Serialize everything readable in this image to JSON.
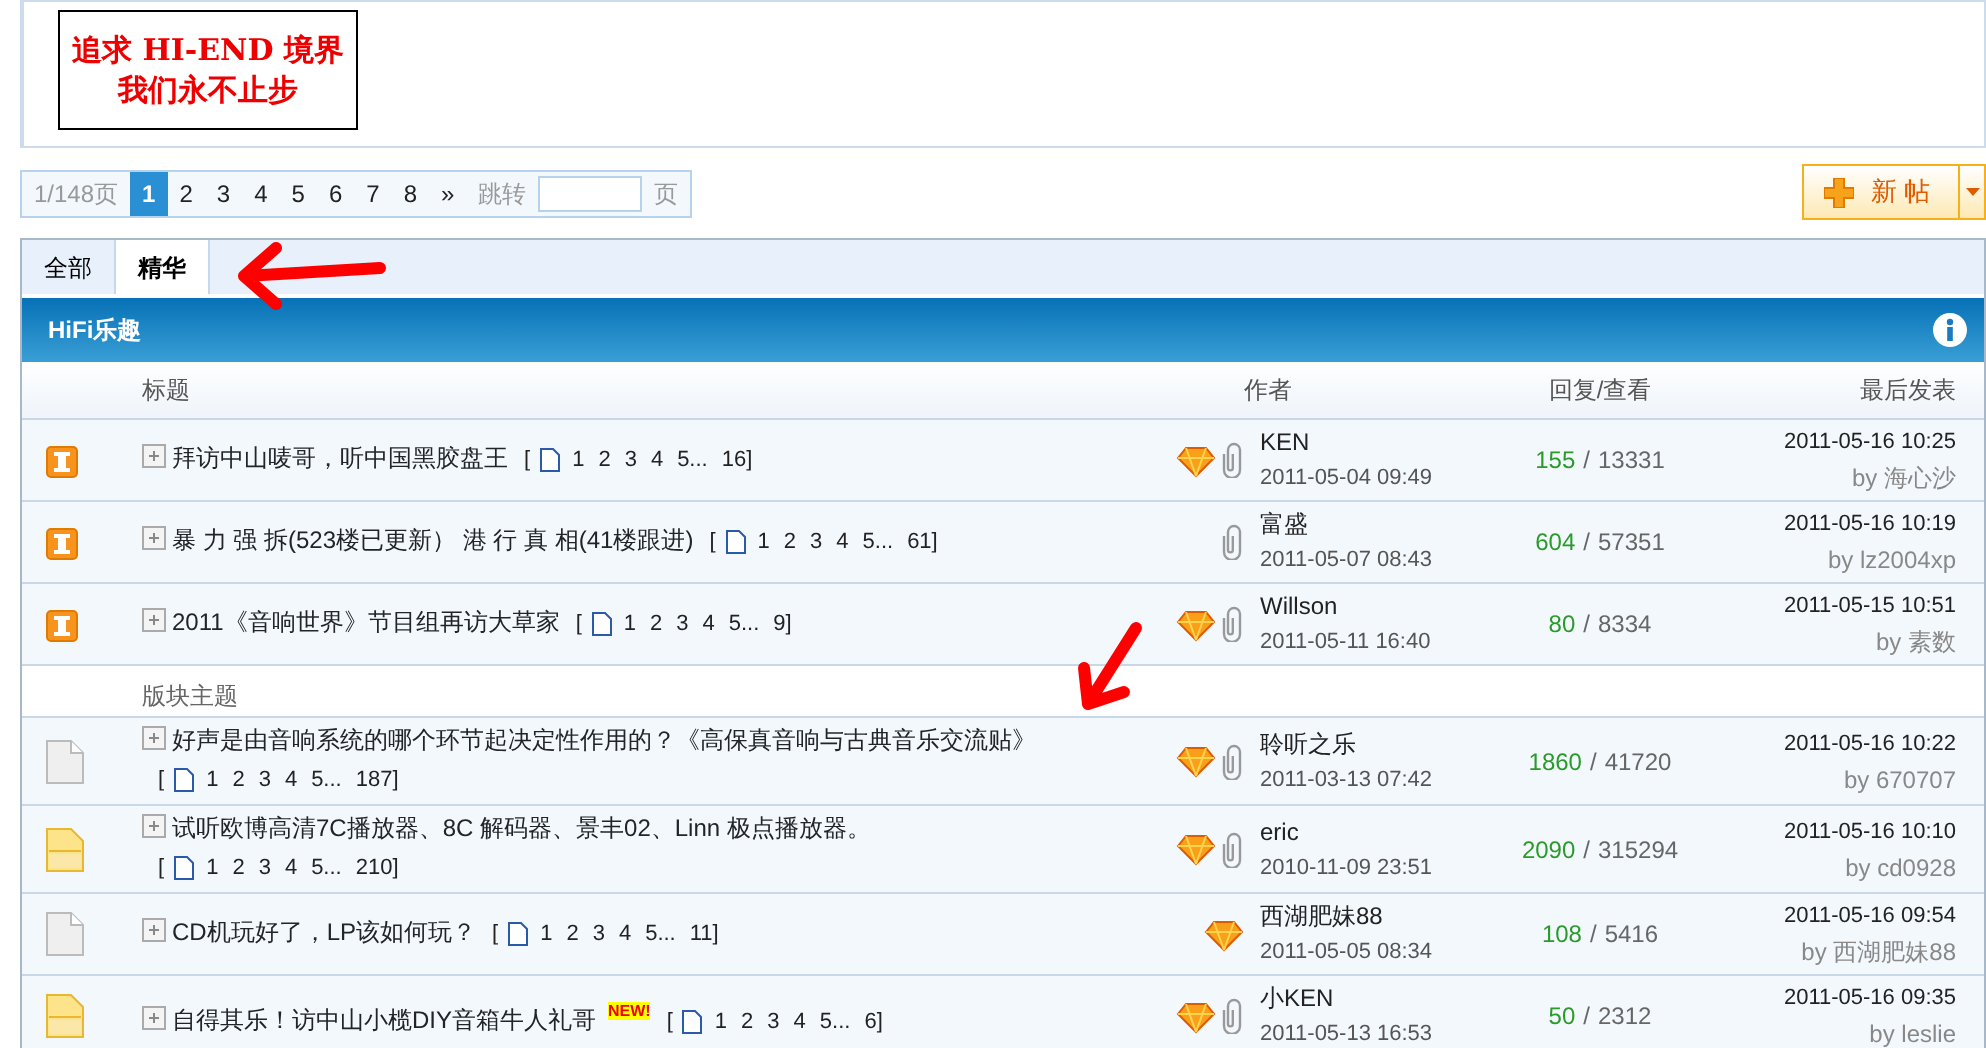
{
  "banner": {
    "lines": [
      "追求 HI-END 境界",
      "我们永不止步"
    ]
  },
  "pager": {
    "summary": "1/148页",
    "pages": [
      {
        "label": "1",
        "selected": true
      },
      {
        "label": "2",
        "selected": false
      },
      {
        "label": "3",
        "selected": false
      },
      {
        "label": "4",
        "selected": false
      },
      {
        "label": "5",
        "selected": false
      },
      {
        "label": "6",
        "selected": false
      },
      {
        "label": "7",
        "selected": false
      },
      {
        "label": "8",
        "selected": false
      }
    ],
    "next": "»",
    "jump_label": "跳转",
    "jump_suffix": "页"
  },
  "new_post_button": {
    "label": "新 帖"
  },
  "tabs": [
    {
      "label": "全部",
      "selected": false
    },
    {
      "label": "精华",
      "selected": true
    }
  ],
  "forum": {
    "title": "HiFi乐趣"
  },
  "columns": [
    "标题",
    "作者",
    "回复/查看",
    "最后发表"
  ],
  "pinned_threads": [
    {
      "kind": "sticky",
      "title": "拜访中山唛哥，听中国黑胶盘王",
      "new": false,
      "pages_open": "[",
      "pages": [
        "1",
        "2",
        "3",
        "4",
        "5...",
        "16]"
      ],
      "separator": "/",
      "digest": true,
      "attachment": true,
      "author": "KEN",
      "posted": "2011-05-04 09:49",
      "replies": "155",
      "views": "13331",
      "last_time": "2011-05-16 10:25",
      "last_by": "by 海心沙"
    },
    {
      "kind": "sticky",
      "title": "暴 力 强 拆(523楼已更新） 港 行 真 相(41楼跟进)",
      "new": false,
      "pages_open": "[",
      "pages": [
        "1",
        "2",
        "3",
        "4",
        "5...",
        "61]"
      ],
      "separator": "/",
      "digest": false,
      "attachment": true,
      "author": "富盛",
      "posted": "2011-05-07 08:43",
      "replies": "604",
      "views": "57351",
      "last_time": "2011-05-16 10:19",
      "last_by": "by lz2004xp"
    },
    {
      "kind": "sticky",
      "title": "2011《音响世界》节目组再访大草家",
      "new": false,
      "pages_open": "[",
      "pages": [
        "1",
        "2",
        "3",
        "4",
        "5...",
        "9]"
      ],
      "separator": "/",
      "digest": true,
      "attachment": true,
      "author": "Willson",
      "posted": "2011-05-11 16:40",
      "replies": "80",
      "views": "8334",
      "last_time": "2011-05-15 10:51",
      "last_by": "by 素数"
    }
  ],
  "section_label": "版块主题",
  "threads": [
    {
      "kind": "normal",
      "title": "好声是由音响系统的哪个环节起决定性作用的？《高保真音响与古典音乐交流贴》",
      "new": false,
      "pages_open": "[",
      "pages": [
        "1",
        "2",
        "3",
        "4",
        "5...",
        "187]"
      ],
      "separator": "/",
      "digest": true,
      "attachment": true,
      "author": "聆听之乐",
      "posted": "2011-03-13 07:42",
      "replies": "1860",
      "views": "41720",
      "last_time": "2011-05-16 10:22",
      "last_by": "by 670707"
    },
    {
      "kind": "hot",
      "title": "试听欧博高清7C播放器、8C 解码器、景丰02、Linn 极点播放器。",
      "new": false,
      "pages_open": "[",
      "pages": [
        "1",
        "2",
        "3",
        "4",
        "5...",
        "210]"
      ],
      "separator": "/",
      "digest": true,
      "attachment": true,
      "author": "eric",
      "posted": "2010-11-09 23:51",
      "replies": "2090",
      "views": "315294",
      "last_time": "2011-05-16 10:10",
      "last_by": "by cd0928"
    },
    {
      "kind": "normal",
      "title": "CD机玩好了，LP该如何玩？",
      "new": false,
      "pages_open": "[",
      "pages": [
        "1",
        "2",
        "3",
        "4",
        "5...",
        "11]"
      ],
      "separator": "/",
      "digest": true,
      "attachment": false,
      "author": "西湖肥妹88",
      "posted": "2011-05-05 08:34",
      "replies": "108",
      "views": "5416",
      "last_time": "2011-05-16 09:54",
      "last_by": "by 西湖肥妹88"
    },
    {
      "kind": "hot",
      "title": "自得其乐！访中山小榄DIY音箱牛人礼哥",
      "new": true,
      "new_badge": "NEW!",
      "pages_open": "[",
      "pages": [
        "1",
        "2",
        "3",
        "4",
        "5...",
        "6]"
      ],
      "separator": "/",
      "digest": true,
      "attachment": true,
      "author": "小KEN",
      "posted": "2011-05-13 16:53",
      "replies": "50",
      "views": "2312",
      "last_time": "2011-05-16 09:35",
      "last_by": "by leslie"
    }
  ]
}
